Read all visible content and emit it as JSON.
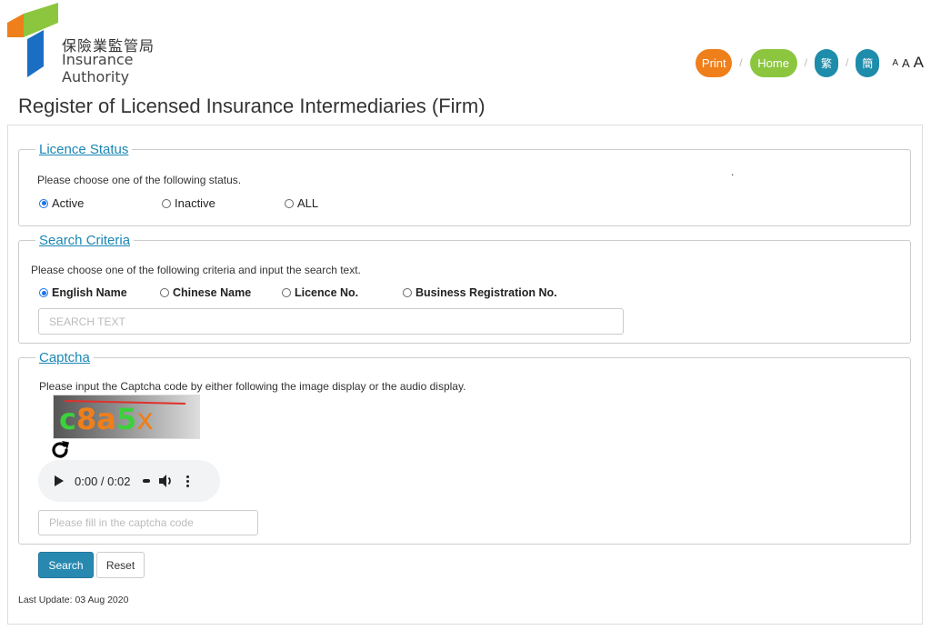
{
  "header": {
    "logo_zh": "保險業監管局",
    "logo_en": "Insurance Authority",
    "nav": {
      "print": "Print",
      "home": "Home",
      "trad_chinese": "繁",
      "simp_chinese": "簡",
      "separator": "/",
      "font_small": "A",
      "font_medium": "A",
      "font_large": "A"
    }
  },
  "page": {
    "title": "Register of Licensed Insurance Intermediaries (Firm)"
  },
  "licence_status": {
    "legend": "Licence Status",
    "hint": "Please choose one of the following status.",
    "dot": ".",
    "options": [
      {
        "label": "Active",
        "checked": true
      },
      {
        "label": "Inactive",
        "checked": false
      },
      {
        "label": "ALL",
        "checked": false
      }
    ]
  },
  "search_criteria": {
    "legend": "Search Criteria",
    "hint": "Please choose one of the following criteria and input the search text.",
    "options": [
      {
        "label": "English Name",
        "checked": true
      },
      {
        "label": "Chinese Name",
        "checked": false
      },
      {
        "label": "Licence No.",
        "checked": false
      },
      {
        "label": "Business Registration No.",
        "checked": false
      }
    ],
    "search_placeholder": "SEARCH TEXT"
  },
  "captcha": {
    "legend": "Captcha",
    "hint": "Please input the Captcha code by either following the image display or the audio display.",
    "image_text": "c8a5x",
    "audio_time": "0:00 / 0:02",
    "input_placeholder": "Please fill in the captcha code"
  },
  "actions": {
    "search": "Search",
    "reset": "Reset"
  },
  "footer": {
    "last_update": "Last Update: 03 Aug 2020"
  },
  "colors": {
    "brand_orange": "#ef7f1a",
    "brand_green": "#8cc63f",
    "brand_blue": "#1e8cab",
    "link_blue": "#1a87b5",
    "button_blue": "#2889b0"
  }
}
